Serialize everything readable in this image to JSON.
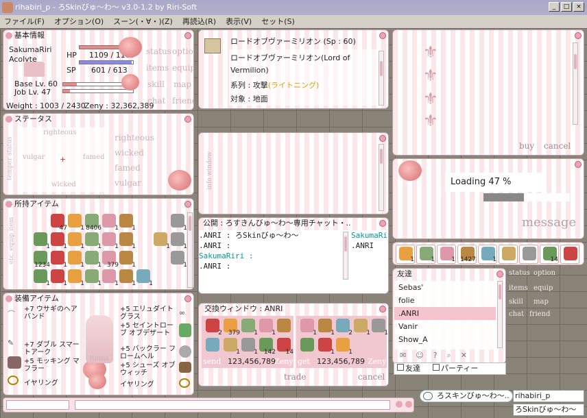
{
  "window": {
    "title": "rihabiri_p - ろSkinびゅ～わ～ v3.0-1.2 by Riri-Soft",
    "min": "_",
    "max": "□",
    "close": "×"
  },
  "menu": [
    "ファイル(F)",
    "オプション(O)",
    "スーン(・∀・)(Z)",
    "再読込(R)",
    "表示(V)",
    "セット(S)"
  ],
  "basic": {
    "title": "基本情報",
    "name": "SakumaRiri",
    "job": "Acolyte",
    "hp_label": "HP",
    "hp": "1109 / 1109",
    "sp_label": "SP",
    "sp": "601 / 613",
    "hp_ratio": 1.0,
    "sp_ratio": 0.98,
    "base_lv": "Base Lv. 60",
    "job_lv": "Job Lv. 47",
    "weight": "Weight : 1003 / 2430",
    "zeny": "Zeny : 32,362,389",
    "buttons": [
      "status",
      "option",
      "items",
      "equip",
      "skill",
      "map",
      "chat",
      "friend"
    ]
  },
  "skill": {
    "name": "ロードオブヴァーミリオン (Sp : 60)",
    "desc1": "ロードオブヴァーミリオン(Lord of",
    "desc2": "Vermilion)",
    "type_label": "系列 : 攻撃",
    "type_value": "(ライトニング)",
    "target": "対象 : 地面",
    "type_color": "#e0a000"
  },
  "shop": {
    "buy": "buy",
    "cancel": "cancel"
  },
  "status": {
    "title": "ステータス",
    "axis_labels": [
      "righteous",
      "vulgar",
      "famed",
      "wicked",
      "temper status"
    ],
    "right_labels": [
      "righteous",
      "wicked",
      "famed",
      "vulgar"
    ]
  },
  "info": {
    "vertical": "info window"
  },
  "loading": {
    "text": "Loading 47 %",
    "progress": 0.47,
    "caption": "message"
  },
  "inventory": {
    "title": "所持アイテム",
    "qty": [
      "",
      "47",
      "1",
      "8406",
      "1",
      "1",
      "",
      "",
      "1",
      "1",
      "1",
      "1",
      "1",
      "1",
      "1",
      "",
      "1",
      "1",
      "1234",
      "1",
      "1",
      "1",
      "379",
      "1",
      "",
      "",
      "1",
      "1",
      "1",
      "1",
      "1",
      "1",
      "1",
      "1",
      ""
    ],
    "tabs": "etc. equip item"
  },
  "chat": {
    "title": "公開 : ろすきんびゅ～わ～専用チャット・..",
    "lines": [
      ".ANRI : ろSkinびゅ～わ～",
      ".ANRI :",
      "SakumaRiri :",
      ".ANRI :"
    ],
    "name_color": "#009999",
    "right_lines": [
      "SakumaRiri",
      ".ANRI"
    ]
  },
  "hotbar": {
    "qty": [
      "1",
      "1",
      "1",
      "1427",
      "1",
      "",
      "",
      "14",
      ""
    ]
  },
  "friends": {
    "title": "友達",
    "list": [
      "Sebas'",
      "folie",
      ".ANRI",
      "Vanir",
      "Show_A"
    ],
    "selected": 2,
    "check1": "友達",
    "check2": "パーティー"
  },
  "equip": {
    "title": "装備アイテム",
    "left": [
      "+7 ウサギのヘアバンド",
      "+7 ダブル スマートアーク",
      "+5 モッキング マフラー",
      "イヤリング"
    ],
    "right": [
      "+5 エリュダイト グラス",
      "+5 セイントローブ オブデザート",
      "+5 バックラー フロームヘル",
      "+5 シューズ オブ ウィッチ",
      "イヤリング"
    ],
    "label": "items"
  },
  "trade": {
    "title": "交換ウィンドウ : ANRI",
    "left_qty": [
      "2",
      "379",
      "1",
      "1",
      "",
      "",
      "1",
      "1",
      "142",
      "14"
    ],
    "right_qty": [
      "1",
      "1",
      "2",
      "1",
      "1",
      "",
      "1",
      "1"
    ],
    "send_label": "send",
    "send_zeny": "123,456,789",
    "get_label": "get",
    "get_zeny": "123,456,789",
    "zeny_label": "Zeny",
    "trade_btn": "trade",
    "cancel_btn": "cancel"
  },
  "mini": {
    "labels": [
      "status",
      "option",
      "items",
      "equip",
      "skill",
      "map",
      "chat",
      "friend"
    ]
  },
  "bottom": {
    "bubble": "ろスキンびゅ～わ～..",
    "char": "rihabiri_p",
    "skin": "ろSkinびゅ～わ～"
  }
}
